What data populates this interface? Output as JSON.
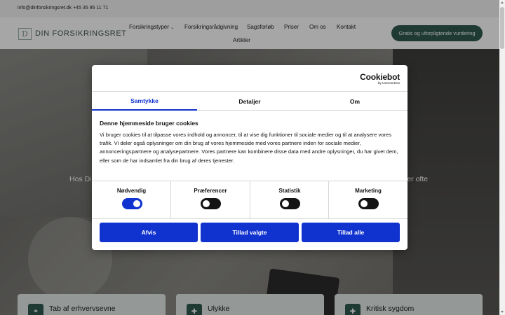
{
  "topbar": {
    "contact": "info@dinforsikringsret.dk  +45 35 95 11 71"
  },
  "header": {
    "logo_letter": "D",
    "logo_text": "DIN FORSIKRINGSRET",
    "nav": [
      "Forsikringstyper",
      "Forsikringsrådgivning",
      "Sagsforløb",
      "Priser",
      "Om os",
      "Kontakt",
      "Artikler"
    ],
    "cta": "Gratis og uforpligtende vurdering"
  },
  "hero": {
    "text_left": "Hos Di",
    "text_right": "ler ofte"
  },
  "cards": [
    {
      "title": "Tab af erhvervsevne",
      "icon": "handshake-icon"
    },
    {
      "title": "Ulykke",
      "icon": "medical-kit-icon"
    },
    {
      "title": "Kritisk sygdom",
      "icon": "hospital-icon"
    }
  ],
  "cookie": {
    "brand": "Cookiebot",
    "brand_sub": "by Usercentrics",
    "tabs": [
      "Samtykke",
      "Detaljer",
      "Om"
    ],
    "active_tab": "Samtykke",
    "heading": "Denne hjemmeside bruger cookies",
    "body": "Vi bruger cookies til at tilpasse vores indhold og annoncer, til at vise dig funktioner til sociale medier og til at analysere vores trafik. Vi deler også oplysninger om din brug af vores hjemmeside med vores partnere inden for sociale medier, annonceringspartnere og analysepartnere. Vores partnere kan kombinere disse data med andre oplysninger, du har givet dem, eller som de har indsamlet fra din brug af deres tjenester.",
    "toggles": [
      {
        "label": "Nødvendig",
        "state": "on"
      },
      {
        "label": "Præferencer",
        "state": "off"
      },
      {
        "label": "Statistik",
        "state": "off"
      },
      {
        "label": "Marketing",
        "state": "off"
      }
    ],
    "buttons": [
      "Afvis",
      "Tillad valgte",
      "Tillad alle"
    ],
    "accent": "#1032cf"
  },
  "colors": {
    "brand_green": "#2f5a4e"
  }
}
